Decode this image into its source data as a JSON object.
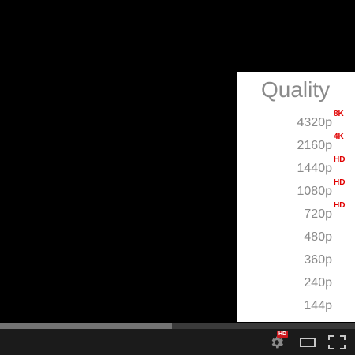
{
  "quality_menu": {
    "title": "Quality",
    "options": [
      {
        "label": "4320p",
        "badge": "8K"
      },
      {
        "label": "2160p",
        "badge": "4K"
      },
      {
        "label": "1440p",
        "badge": "HD"
      },
      {
        "label": "1080p",
        "badge": "HD"
      },
      {
        "label": "720p",
        "badge": "HD"
      },
      {
        "label": "480p",
        "badge": ""
      },
      {
        "label": "360p",
        "badge": ""
      },
      {
        "label": "240p",
        "badge": ""
      },
      {
        "label": "144p",
        "badge": ""
      }
    ]
  },
  "progress": {
    "buffered_fraction": 0.485
  },
  "controls": {
    "settings_badge": "HD",
    "settings_icon": "gear-icon",
    "theater_icon": "theater-mode-icon",
    "fullscreen_icon": "fullscreen-icon"
  },
  "colors": {
    "menu_text": "#8a8a8a",
    "badge_red": "#e00000",
    "hd_badge_bg": "#cc181e",
    "control_bar": "#1b1b1b",
    "progress_track": "#3a3a3a",
    "progress_buffered": "#737373"
  }
}
